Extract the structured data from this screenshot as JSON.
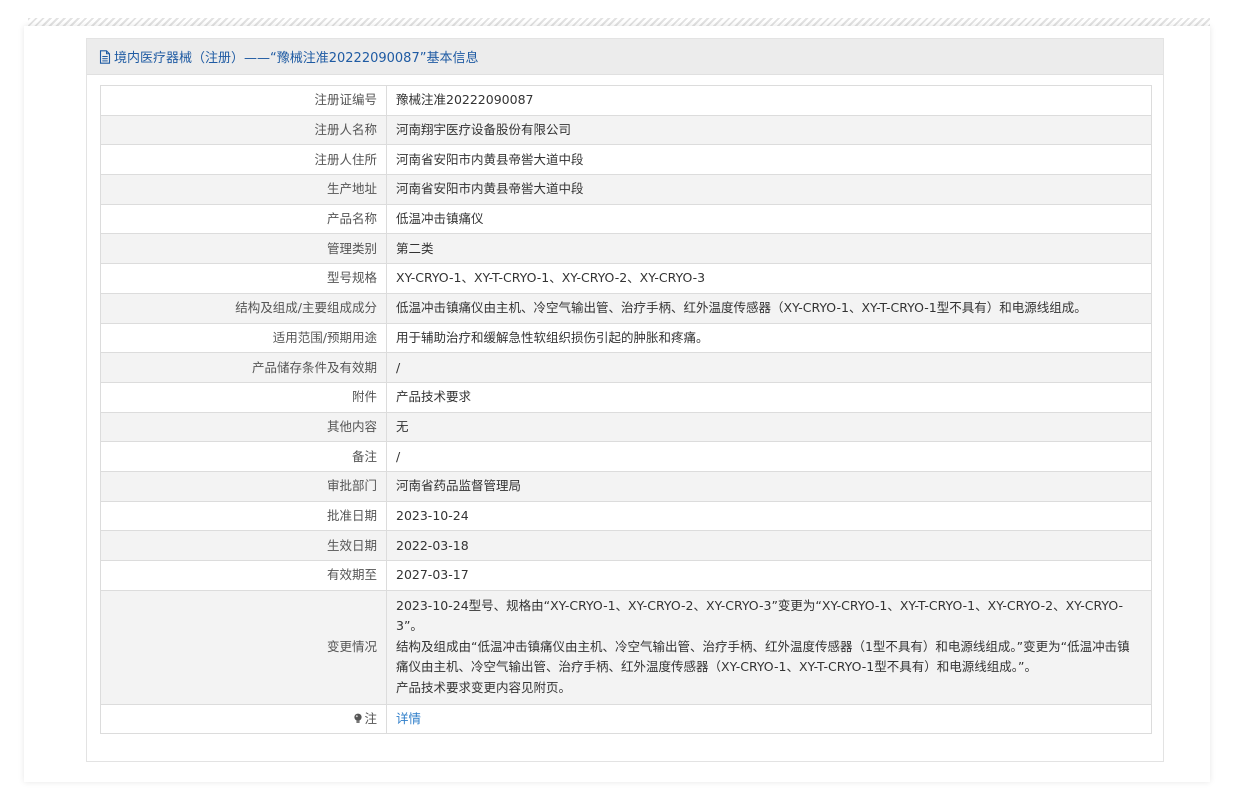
{
  "header": {
    "title": "境内医疗器械（注册）——“豫械注准20222090087”基本信息",
    "icon": "document-icon"
  },
  "rows": [
    {
      "label": "注册证编号",
      "value": "豫械注准20222090087"
    },
    {
      "label": "注册人名称",
      "value": "河南翔宇医疗设备股份有限公司"
    },
    {
      "label": "注册人住所",
      "value": "河南省安阳市内黄县帝喾大道中段"
    },
    {
      "label": "生产地址",
      "value": "河南省安阳市内黄县帝喾大道中段"
    },
    {
      "label": "产品名称",
      "value": "低温冲击镇痛仪"
    },
    {
      "label": "管理类别",
      "value": "第二类"
    },
    {
      "label": "型号规格",
      "value": "XY-CRYO-1、XY-T-CRYO-1、XY-CRYO-2、XY-CRYO-3"
    },
    {
      "label": "结构及组成/主要组成成分",
      "value": "低温冲击镇痛仪由主机、冷空气输出管、治疗手柄、红外温度传感器（XY-CRYO-1、XY-T-CRYO-1型不具有）和电源线组成。"
    },
    {
      "label": "适用范围/预期用途",
      "value": "用于辅助治疗和缓解急性软组织损伤引起的肿胀和疼痛。"
    },
    {
      "label": "产品储存条件及有效期",
      "value": "/"
    },
    {
      "label": "附件",
      "value": "产品技术要求"
    },
    {
      "label": "其他内容",
      "value": "无"
    },
    {
      "label": "备注",
      "value": "/"
    },
    {
      "label": "审批部门",
      "value": "河南省药品监督管理局"
    },
    {
      "label": "批准日期",
      "value": "2023-10-24"
    },
    {
      "label": "生效日期",
      "value": "2022-03-18"
    },
    {
      "label": "有效期至",
      "value": "2027-03-17"
    }
  ],
  "change": {
    "label": "变更情况",
    "lines": [
      "2023-10-24型号、规格由“XY-CRYO-1、XY-CRYO-2、XY-CRYO-3”变更为“XY-CRYO-1、XY-T-CRYO-1、XY-CRYO-2、XY-CRYO-3”。",
      "结构及组成由“低温冲击镇痛仪由主机、冷空气输出管、治疗手柄、红外温度传感器（1型不具有）和电源线组成。”变更为“低温冲击镇痛仪由主机、冷空气输出管、治疗手柄、红外温度传感器（XY-CRYO-1、XY-T-CRYO-1型不具有）和电源线组成。”。",
      "产品技术要求变更内容见附页。"
    ]
  },
  "note": {
    "label": "注",
    "icon": "lightbulb-icon",
    "link_text": "详情"
  },
  "colors": {
    "header_text": "#1f5ba3",
    "link": "#2d7dc9",
    "row_alt": "#f3f3f3"
  }
}
